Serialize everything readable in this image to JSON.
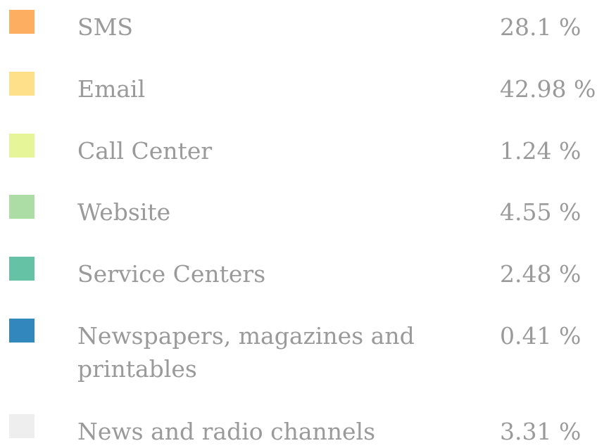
{
  "chart_data": {
    "type": "pie",
    "categories": [
      "SMS",
      "Email",
      "Call Center",
      "Website",
      "Service Centers",
      "Newspapers, magazines and printables",
      "News and radio channels"
    ],
    "values": [
      28.1,
      42.98,
      1.24,
      4.55,
      2.48,
      0.41,
      3.31
    ],
    "value_labels": [
      "28.1 %",
      "42.98 %",
      "1.24 %",
      "4.55 %",
      "2.48 %",
      "0.41 %",
      "3.31 %"
    ],
    "colors": [
      "#fdae61",
      "#fee08b",
      "#e6f598",
      "#abdda4",
      "#66c2a5",
      "#3288bd",
      "#eeeeee"
    ],
    "legend_position": "left"
  }
}
